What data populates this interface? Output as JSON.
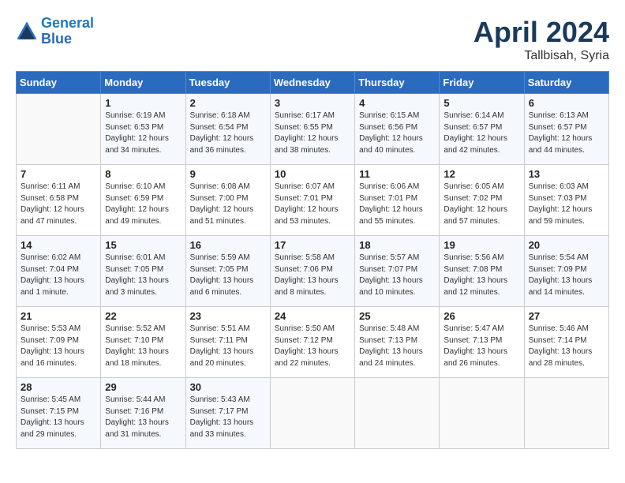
{
  "header": {
    "logo_line1": "General",
    "logo_line2": "Blue",
    "month": "April 2024",
    "location": "Tallbisah, Syria"
  },
  "weekdays": [
    "Sunday",
    "Monday",
    "Tuesday",
    "Wednesday",
    "Thursday",
    "Friday",
    "Saturday"
  ],
  "weeks": [
    [
      {
        "day": "",
        "info": ""
      },
      {
        "day": "1",
        "info": "Sunrise: 6:19 AM\nSunset: 6:53 PM\nDaylight: 12 hours\nand 34 minutes."
      },
      {
        "day": "2",
        "info": "Sunrise: 6:18 AM\nSunset: 6:54 PM\nDaylight: 12 hours\nand 36 minutes."
      },
      {
        "day": "3",
        "info": "Sunrise: 6:17 AM\nSunset: 6:55 PM\nDaylight: 12 hours\nand 38 minutes."
      },
      {
        "day": "4",
        "info": "Sunrise: 6:15 AM\nSunset: 6:56 PM\nDaylight: 12 hours\nand 40 minutes."
      },
      {
        "day": "5",
        "info": "Sunrise: 6:14 AM\nSunset: 6:57 PM\nDaylight: 12 hours\nand 42 minutes."
      },
      {
        "day": "6",
        "info": "Sunrise: 6:13 AM\nSunset: 6:57 PM\nDaylight: 12 hours\nand 44 minutes."
      }
    ],
    [
      {
        "day": "7",
        "info": "Sunrise: 6:11 AM\nSunset: 6:58 PM\nDaylight: 12 hours\nand 47 minutes."
      },
      {
        "day": "8",
        "info": "Sunrise: 6:10 AM\nSunset: 6:59 PM\nDaylight: 12 hours\nand 49 minutes."
      },
      {
        "day": "9",
        "info": "Sunrise: 6:08 AM\nSunset: 7:00 PM\nDaylight: 12 hours\nand 51 minutes."
      },
      {
        "day": "10",
        "info": "Sunrise: 6:07 AM\nSunset: 7:01 PM\nDaylight: 12 hours\nand 53 minutes."
      },
      {
        "day": "11",
        "info": "Sunrise: 6:06 AM\nSunset: 7:01 PM\nDaylight: 12 hours\nand 55 minutes."
      },
      {
        "day": "12",
        "info": "Sunrise: 6:05 AM\nSunset: 7:02 PM\nDaylight: 12 hours\nand 57 minutes."
      },
      {
        "day": "13",
        "info": "Sunrise: 6:03 AM\nSunset: 7:03 PM\nDaylight: 12 hours\nand 59 minutes."
      }
    ],
    [
      {
        "day": "14",
        "info": "Sunrise: 6:02 AM\nSunset: 7:04 PM\nDaylight: 13 hours\nand 1 minute."
      },
      {
        "day": "15",
        "info": "Sunrise: 6:01 AM\nSunset: 7:05 PM\nDaylight: 13 hours\nand 3 minutes."
      },
      {
        "day": "16",
        "info": "Sunrise: 5:59 AM\nSunset: 7:05 PM\nDaylight: 13 hours\nand 6 minutes."
      },
      {
        "day": "17",
        "info": "Sunrise: 5:58 AM\nSunset: 7:06 PM\nDaylight: 13 hours\nand 8 minutes."
      },
      {
        "day": "18",
        "info": "Sunrise: 5:57 AM\nSunset: 7:07 PM\nDaylight: 13 hours\nand 10 minutes."
      },
      {
        "day": "19",
        "info": "Sunrise: 5:56 AM\nSunset: 7:08 PM\nDaylight: 13 hours\nand 12 minutes."
      },
      {
        "day": "20",
        "info": "Sunrise: 5:54 AM\nSunset: 7:09 PM\nDaylight: 13 hours\nand 14 minutes."
      }
    ],
    [
      {
        "day": "21",
        "info": "Sunrise: 5:53 AM\nSunset: 7:09 PM\nDaylight: 13 hours\nand 16 minutes."
      },
      {
        "day": "22",
        "info": "Sunrise: 5:52 AM\nSunset: 7:10 PM\nDaylight: 13 hours\nand 18 minutes."
      },
      {
        "day": "23",
        "info": "Sunrise: 5:51 AM\nSunset: 7:11 PM\nDaylight: 13 hours\nand 20 minutes."
      },
      {
        "day": "24",
        "info": "Sunrise: 5:50 AM\nSunset: 7:12 PM\nDaylight: 13 hours\nand 22 minutes."
      },
      {
        "day": "25",
        "info": "Sunrise: 5:48 AM\nSunset: 7:13 PM\nDaylight: 13 hours\nand 24 minutes."
      },
      {
        "day": "26",
        "info": "Sunrise: 5:47 AM\nSunset: 7:13 PM\nDaylight: 13 hours\nand 26 minutes."
      },
      {
        "day": "27",
        "info": "Sunrise: 5:46 AM\nSunset: 7:14 PM\nDaylight: 13 hours\nand 28 minutes."
      }
    ],
    [
      {
        "day": "28",
        "info": "Sunrise: 5:45 AM\nSunset: 7:15 PM\nDaylight: 13 hours\nand 29 minutes."
      },
      {
        "day": "29",
        "info": "Sunrise: 5:44 AM\nSunset: 7:16 PM\nDaylight: 13 hours\nand 31 minutes."
      },
      {
        "day": "30",
        "info": "Sunrise: 5:43 AM\nSunset: 7:17 PM\nDaylight: 13 hours\nand 33 minutes."
      },
      {
        "day": "",
        "info": ""
      },
      {
        "day": "",
        "info": ""
      },
      {
        "day": "",
        "info": ""
      },
      {
        "day": "",
        "info": ""
      }
    ]
  ]
}
